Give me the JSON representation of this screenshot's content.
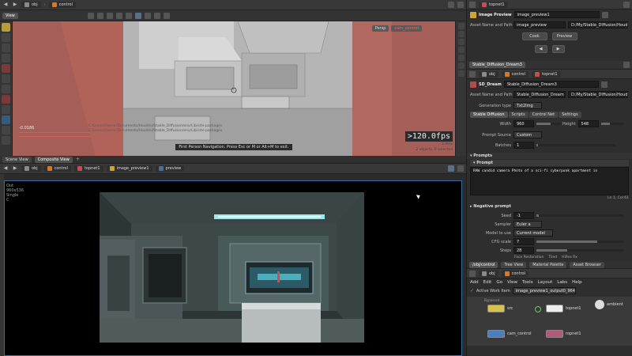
{
  "colors": {
    "accent_red": "#c8473f",
    "viewport_floor": "#a9a9a9",
    "render_bg": "#000000",
    "panel_bg": "#2b2b2b",
    "node_orange": "#d07a2a"
  },
  "top_path": {
    "obj": "obj",
    "network": "control"
  },
  "viewport": {
    "tab_label": "View",
    "cam_mode": "Persp",
    "cam_name": "cam_control",
    "fps": ">120.0fps",
    "fps_sub": "2.4ms",
    "status": "First Person Navigation. Press Esc or M or Alt+M to exit.",
    "selection": "2 objects, 0 selected",
    "coord": "-0.0186",
    "console_lines": [
      "C:/Users/Owner/Documents/Houdini/Stable_Diffusion/env/Lib/site-packages",
      "C:/Users/Owner/Documents/Houdini/Stable_Diffusion/env/Lib/site-packages"
    ]
  },
  "lower_tabs": {
    "scene_view": "Scene View",
    "composite_view": "Composite View"
  },
  "lower_path": {
    "obj": "obj",
    "control": "control",
    "topnet": "topnet1",
    "preview_node": "image_preview1",
    "preview": "preview"
  },
  "render_info": {
    "out": "Out",
    "size": "960x536",
    "mode": "Single",
    "ch": "C"
  },
  "image_preview_panel": {
    "title": "Image Preview",
    "node_name": "image_preview1",
    "asset_label": "Asset Name and Path",
    "asset_name": "image_preview",
    "asset_path": "D:/My/Stable_Diffusion/Houdin",
    "btn_cook": "Cook",
    "btn_preview": "Preview",
    "topnet_path": "topnet1"
  },
  "sd_panel": {
    "type_label": "Stable_Diffusion_Dream3",
    "path_obj": "obj",
    "path_control": "control",
    "path_topnet": "topnet1",
    "node_type": "SD_Dream",
    "node_name": "Stable_Diffusion_Dream3",
    "asset_label": "Asset Name and Path",
    "asset_name": "Stable_Diffusion_Dream",
    "asset_path": "D:/My/Stable_Diffusion/Houdin",
    "gen_type_label": "Generation type",
    "gen_type": "Txt2Img",
    "tabs": [
      "Stable Diffusion",
      "Scripts",
      "Control Net",
      "Settings"
    ],
    "width_label": "Width",
    "width": "960",
    "height_label": "Height",
    "height": "548",
    "prompt_source_label": "Prompt Source",
    "prompt_source": "Custom",
    "batches_label": "Batches",
    "batches": "1",
    "prompts_section": "Prompts",
    "prompt_sub": "Prompt",
    "prompt_text": "RAW candid camera Photo of a sci-fi cyberpunk apartment in",
    "prompt_cursor": "Ln 1, Col 61",
    "negative_section": "Negative prompt",
    "seed_label": "Seed",
    "seed": "-1",
    "sampler_label": "Sampler",
    "sampler": "Euler a",
    "model_label": "Model to use",
    "model": "Current model",
    "cfg_label": "CFG scale",
    "cfg": "7",
    "steps_label": "Steps",
    "steps": "28",
    "face_restore": "Face Restoration",
    "tiled": "Tiled",
    "hires": "HiRes fix"
  },
  "network_panel": {
    "tabs": [
      "/obj/control",
      "Tree View",
      "Material Palette",
      "Asset Browser"
    ],
    "path_obj": "obj",
    "path_control": "control",
    "menu": [
      "Add",
      "Edit",
      "Go",
      "View",
      "Tools",
      "Layout",
      "Labs",
      "Help"
    ],
    "active_label": "Active Work Item",
    "active_item": "image_preview1_output0_964",
    "nodes": {
      "src": "src",
      "topnet": "topnet1",
      "cam": "cam_control",
      "ropnet": "ropnet1",
      "ambient": "ambient",
      "bypass_label": "Bypassed"
    }
  }
}
